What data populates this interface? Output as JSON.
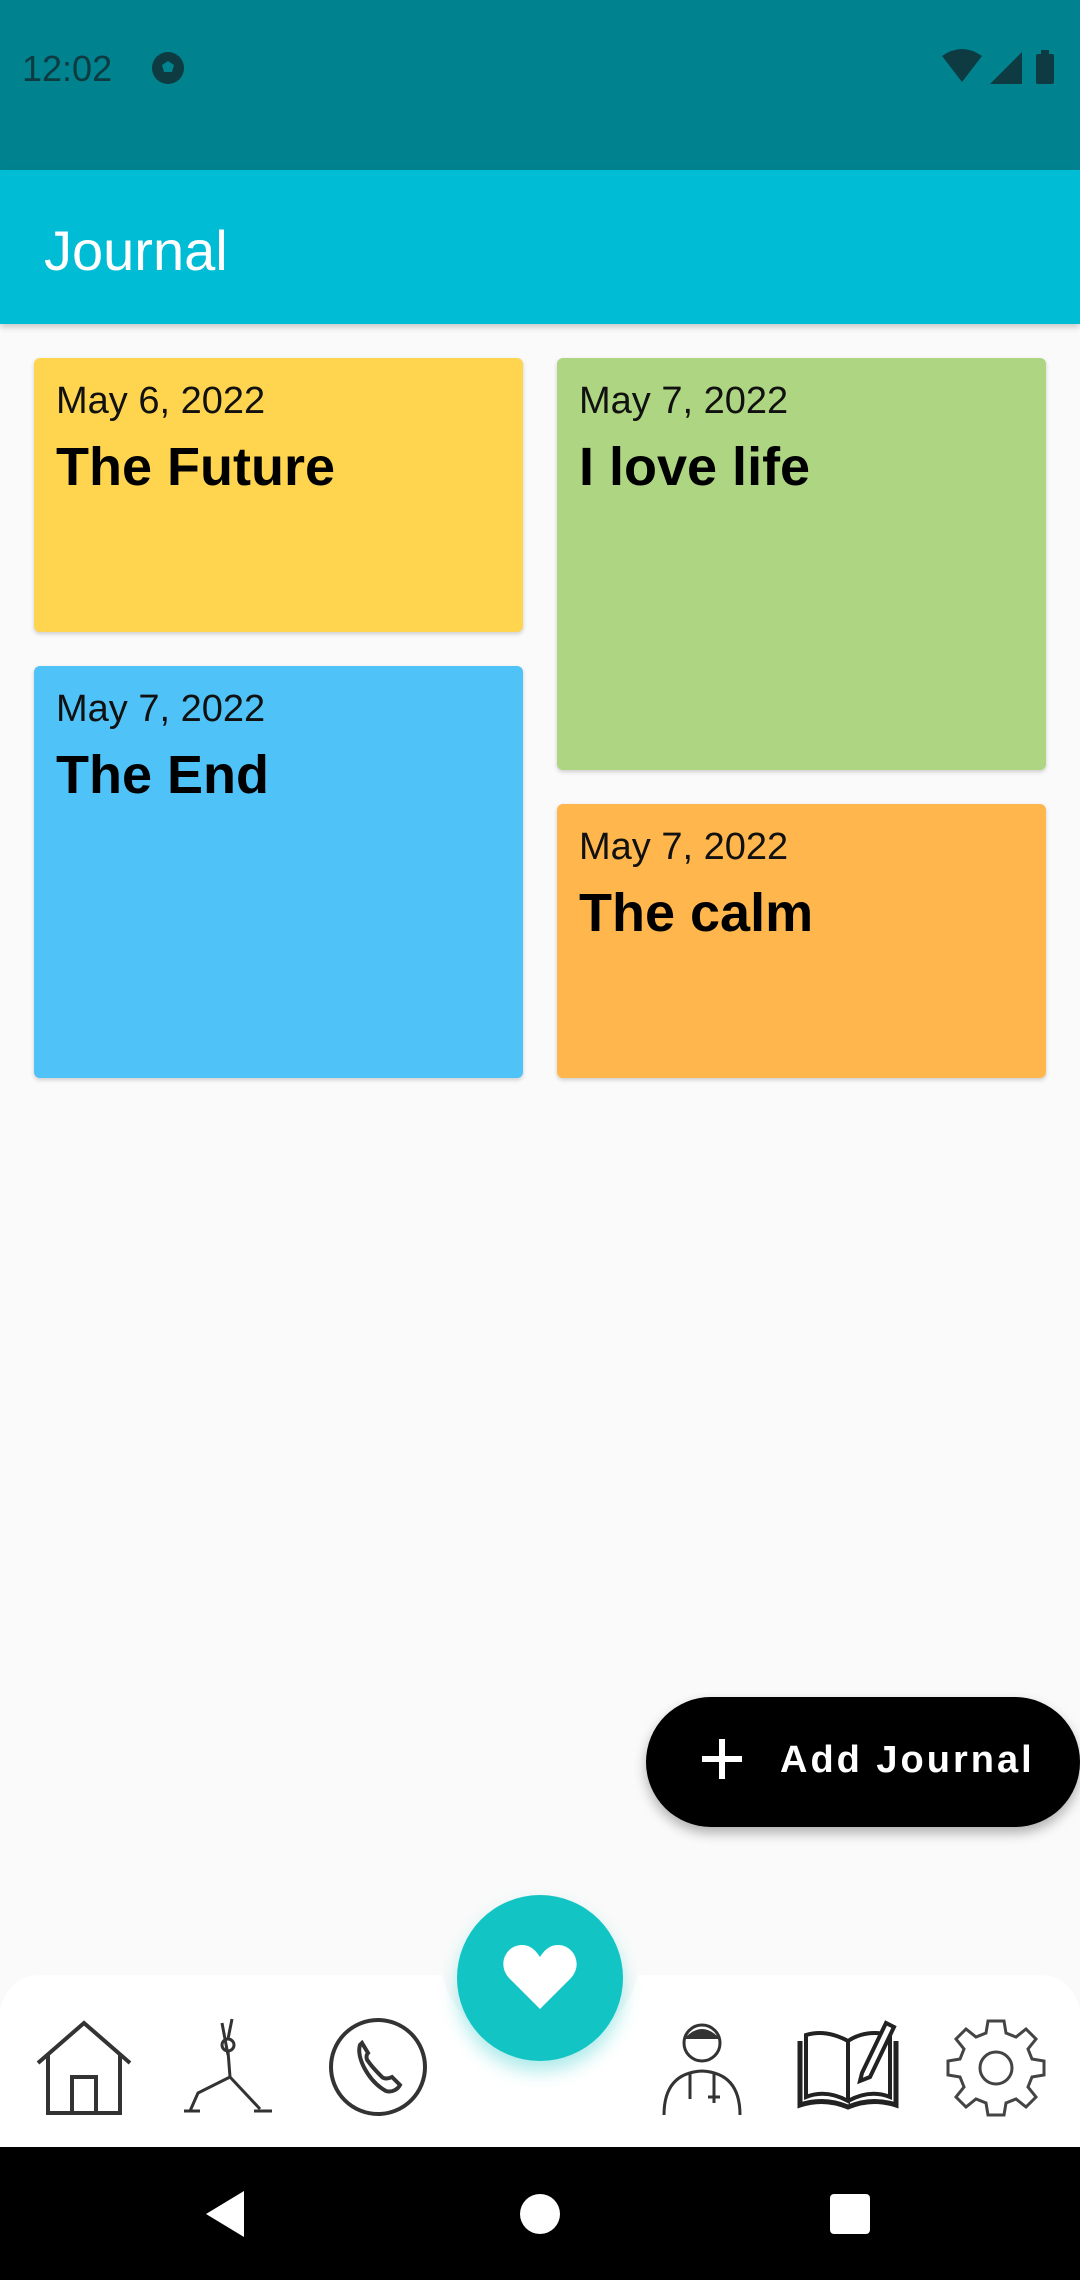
{
  "status_bar": {
    "time": "12:02",
    "icons": [
      "soccer-ball-icon",
      "wifi-icon",
      "signal-icon",
      "battery-icon"
    ],
    "color": "#00838f"
  },
  "app_bar": {
    "title": "Journal",
    "color": "#00bcd4"
  },
  "journals": [
    {
      "date": "May 6, 2022",
      "title": "The Future",
      "color": "#ffd54f"
    },
    {
      "date": "May 7, 2022",
      "title": "I love life",
      "color": "#aed581"
    },
    {
      "date": "May 7, 2022",
      "title": "The End",
      "color": "#4fc3f7"
    },
    {
      "date": "May 7, 2022",
      "title": "The calm",
      "color": "#ffb74d"
    }
  ],
  "fab": {
    "label": "Add Journal",
    "icon": "plus-icon"
  },
  "bottom_nav": {
    "items": [
      {
        "name": "home",
        "icon": "home-icon"
      },
      {
        "name": "yoga",
        "icon": "yoga-icon"
      },
      {
        "name": "call",
        "icon": "phone-icon"
      },
      {
        "name": "mood",
        "icon": "heart-icon",
        "accent": "#12c4c4"
      },
      {
        "name": "doctor",
        "icon": "doctor-icon"
      },
      {
        "name": "journal",
        "icon": "book-icon"
      },
      {
        "name": "settings",
        "icon": "gear-icon"
      }
    ]
  },
  "system_nav": [
    "back-icon",
    "home-circle-icon",
    "recents-icon"
  ]
}
